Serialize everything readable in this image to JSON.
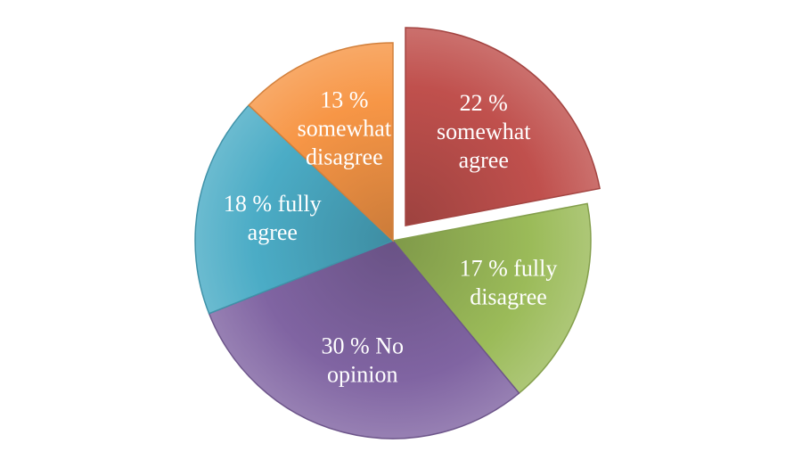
{
  "chart_data": {
    "type": "pie",
    "title": "",
    "slices": [
      {
        "label": "22 % somewhat agree",
        "value": 22,
        "color": "#c0504d",
        "exploded": true
      },
      {
        "label": "17 % fully disagree",
        "value": 17,
        "color": "#9bbb59",
        "exploded": false
      },
      {
        "label": "30 % No opinion",
        "value": 30,
        "color": "#8064a2",
        "exploded": false
      },
      {
        "label": "18 % fully agree",
        "value": 18,
        "color": "#4bacc6",
        "exploded": false
      },
      {
        "label": "13 % somewhat disagree",
        "value": 13,
        "color": "#f79646",
        "exploded": false
      }
    ]
  }
}
